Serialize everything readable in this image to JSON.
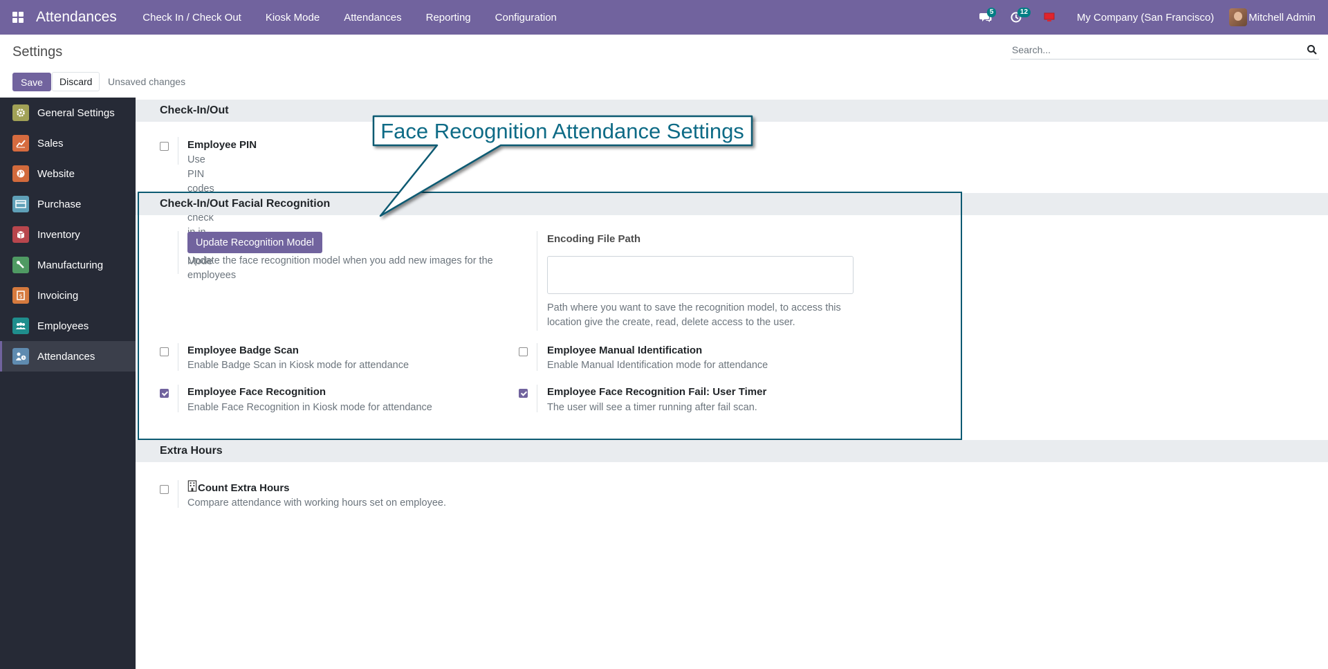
{
  "navbar": {
    "brand": "Attendances",
    "menu": [
      "Check In / Check Out",
      "Kiosk Mode",
      "Attendances",
      "Reporting",
      "Configuration"
    ],
    "messages_badge": "5",
    "activities_badge": "12",
    "company": "My Company (San Francisco)",
    "user": "Mitchell Admin"
  },
  "control_panel": {
    "breadcrumb": "Settings",
    "search_placeholder": "Search...",
    "save_label": "Save",
    "discard_label": "Discard",
    "status": "Unsaved changes"
  },
  "sidebar": {
    "items": [
      {
        "label": "General Settings",
        "icon": "gear-icon",
        "color": "#a1a156"
      },
      {
        "label": "Sales",
        "icon": "chart-icon",
        "color": "#d66b3f"
      },
      {
        "label": "Website",
        "icon": "globe-icon",
        "color": "#d26a3c"
      },
      {
        "label": "Purchase",
        "icon": "card-icon",
        "color": "#5fa0b8"
      },
      {
        "label": "Inventory",
        "icon": "box-icon",
        "color": "#b8464d"
      },
      {
        "label": "Manufacturing",
        "icon": "wrench-icon",
        "color": "#4f9a63"
      },
      {
        "label": "Invoicing",
        "icon": "invoice-icon",
        "color": "#d57a3e"
      },
      {
        "label": "Employees",
        "icon": "people-icon",
        "color": "#1f8e8d"
      },
      {
        "label": "Attendances",
        "icon": "person-clock-icon",
        "color": "#5f8bb0",
        "active": true
      }
    ]
  },
  "sections": {
    "checkinout": {
      "title": "Check-In/Out",
      "employee_pin": {
        "title": "Employee PIN",
        "desc": "Use PIN codes to check in in Kiosk Mode",
        "checked": false
      }
    },
    "facial": {
      "title": "Check-In/Out Facial Recognition",
      "update_button": "Update Recognition Model",
      "update_desc": "Update the face recognition model when you add new images for the employees",
      "encoding_title": "Encoding File Path",
      "encoding_value": "",
      "encoding_desc": "Path where you want to save the recognition model, to access this location give the create, read, delete access to the user.",
      "badge_scan": {
        "title": "Employee Badge Scan",
        "desc": "Enable Badge Scan in Kiosk mode for attendance",
        "checked": false
      },
      "manual_id": {
        "title": "Employee Manual Identification",
        "desc": "Enable Manual Identification mode for attendance",
        "checked": false
      },
      "face_recognition": {
        "title": "Employee Face Recognition",
        "desc": "Enable Face Recognition in Kiosk mode for attendance",
        "checked": true
      },
      "fail_timer": {
        "title": "Employee Face Recognition Fail: User Timer",
        "desc": "The user will see a timer running after fail scan.",
        "checked": true
      }
    },
    "extra_hours": {
      "title": "Extra Hours",
      "count": {
        "title": "Count Extra Hours",
        "desc": "Compare attendance with working hours set on employee.",
        "checked": false
      }
    }
  },
  "annotation": {
    "label": "Face Recognition Attendance Settings",
    "color": "#0e6b86"
  },
  "colors": {
    "brand": "#71639e",
    "sidebar": "#262a36",
    "badge": "#017e84"
  }
}
